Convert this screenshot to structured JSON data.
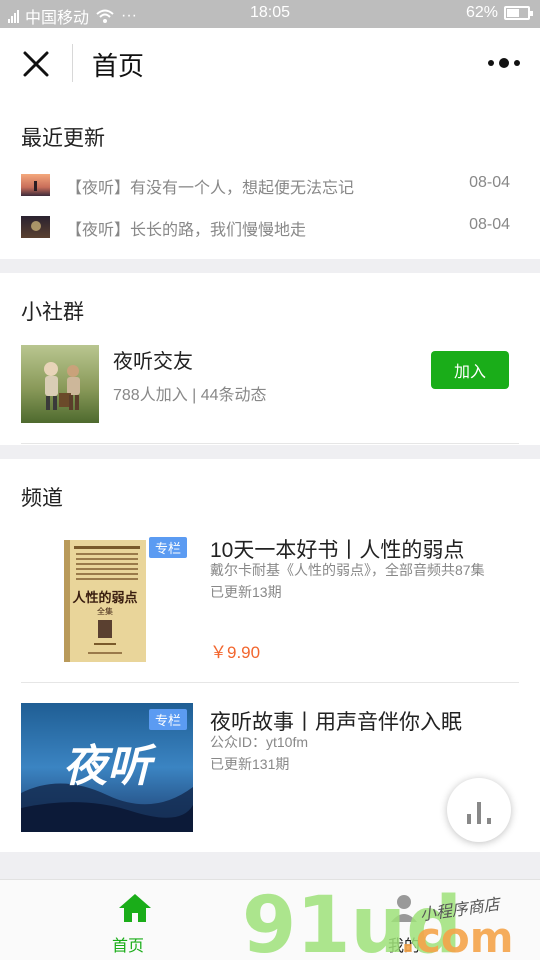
{
  "status_bar": {
    "carrier": "中国移动",
    "dots": "···",
    "time": "18:05",
    "battery": "62%",
    "battery_level": 0.62
  },
  "header": {
    "title": "首页"
  },
  "recent": {
    "title": "最近更新",
    "items": [
      {
        "text": "【夜听】有没有一个人，想起便无法忘记",
        "date": "08-04"
      },
      {
        "text": "【夜听】长长的路，我们慢慢地走",
        "date": "08-04"
      }
    ]
  },
  "group": {
    "section_title": "小社群",
    "name": "夜听交友",
    "stats": "788人加入 | 44条动态",
    "join_label": "加入"
  },
  "channels": {
    "section_title": "频道",
    "items": [
      {
        "badge": "专栏",
        "title": "10天一本好书丨人性的弱点",
        "desc": "戴尔卡耐基《人性的弱点》，全部音频共87集",
        "updated": "已更新13期",
        "price": "￥9.90",
        "cover_title": "人性的弱点",
        "cover_subtitle": "全集"
      },
      {
        "badge": "专栏",
        "title": "夜听故事丨用声音伴你入眠",
        "desc": "公众ID：yt10fm",
        "updated": "已更新131期",
        "cover_text": "夜听"
      }
    ]
  },
  "tabbar": {
    "home_label": "首页",
    "mine_label": "我的"
  },
  "watermark": {
    "brand": "91ud",
    "suffix": ".com",
    "tagline": "小程序商店"
  },
  "colors": {
    "accent_green": "#1aad19",
    "badge_blue": "#5b9bf2",
    "price_orange": "#f2662e",
    "status_bar_bg": "#bdbdbd",
    "section_gap": "#efeff2"
  }
}
